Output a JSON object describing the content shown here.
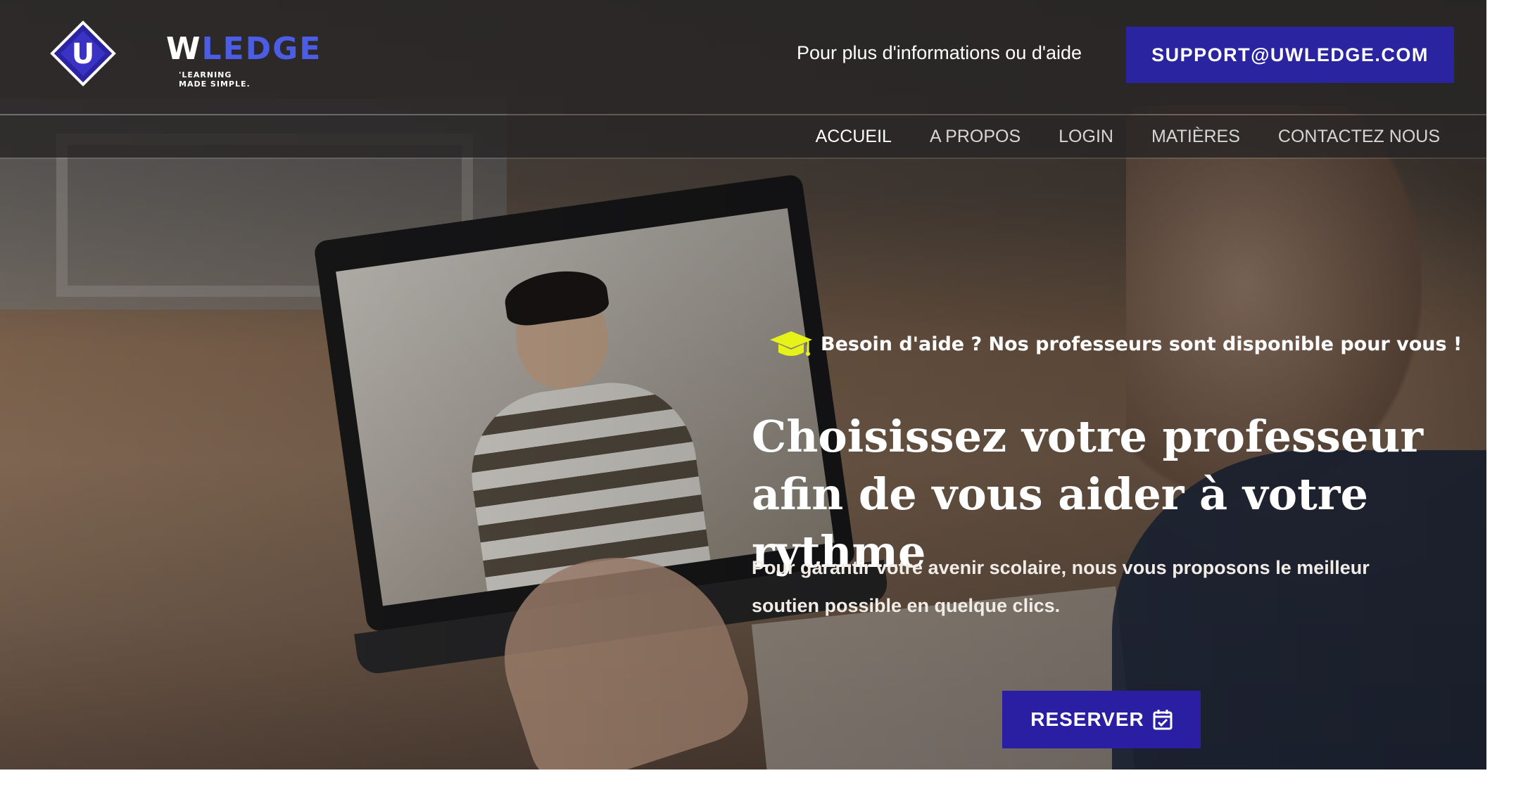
{
  "brand": {
    "logo_mark": "U",
    "logo_text_prefix": "W",
    "logo_text_rest": "LEDGE",
    "tagline": "'LEARNING MADE SIMPLE."
  },
  "header": {
    "info_text": "Pour plus d'informations ou d'aide",
    "support_button": "SUPPORT@UWLEDGE.COM"
  },
  "nav": {
    "items": [
      {
        "label": "ACCUEIL"
      },
      {
        "label": "A PROPOS"
      },
      {
        "label": "LOGIN"
      },
      {
        "label": "MATIÈRES"
      },
      {
        "label": "CONTACTEZ NOUS"
      }
    ]
  },
  "hero": {
    "eyebrow": "Besoin d'aide ? Nos professeurs sont disponible pour vous !",
    "headline": "Choisissez votre professeur afin de vous aider à votre rythme",
    "subtext": "Pour garantir votre avenir scolaire, nous vous proposons le meilleur soutien possible en quelque clics.",
    "reserve_button": "RESERVER"
  },
  "colors": {
    "accent": "#2a24a0",
    "eyebrow_icon": "#e6f218",
    "logo_blue": "#4b5de4"
  },
  "icons": {
    "eyebrow": "graduation-cap-icon",
    "reserve": "calendar-check-icon"
  }
}
